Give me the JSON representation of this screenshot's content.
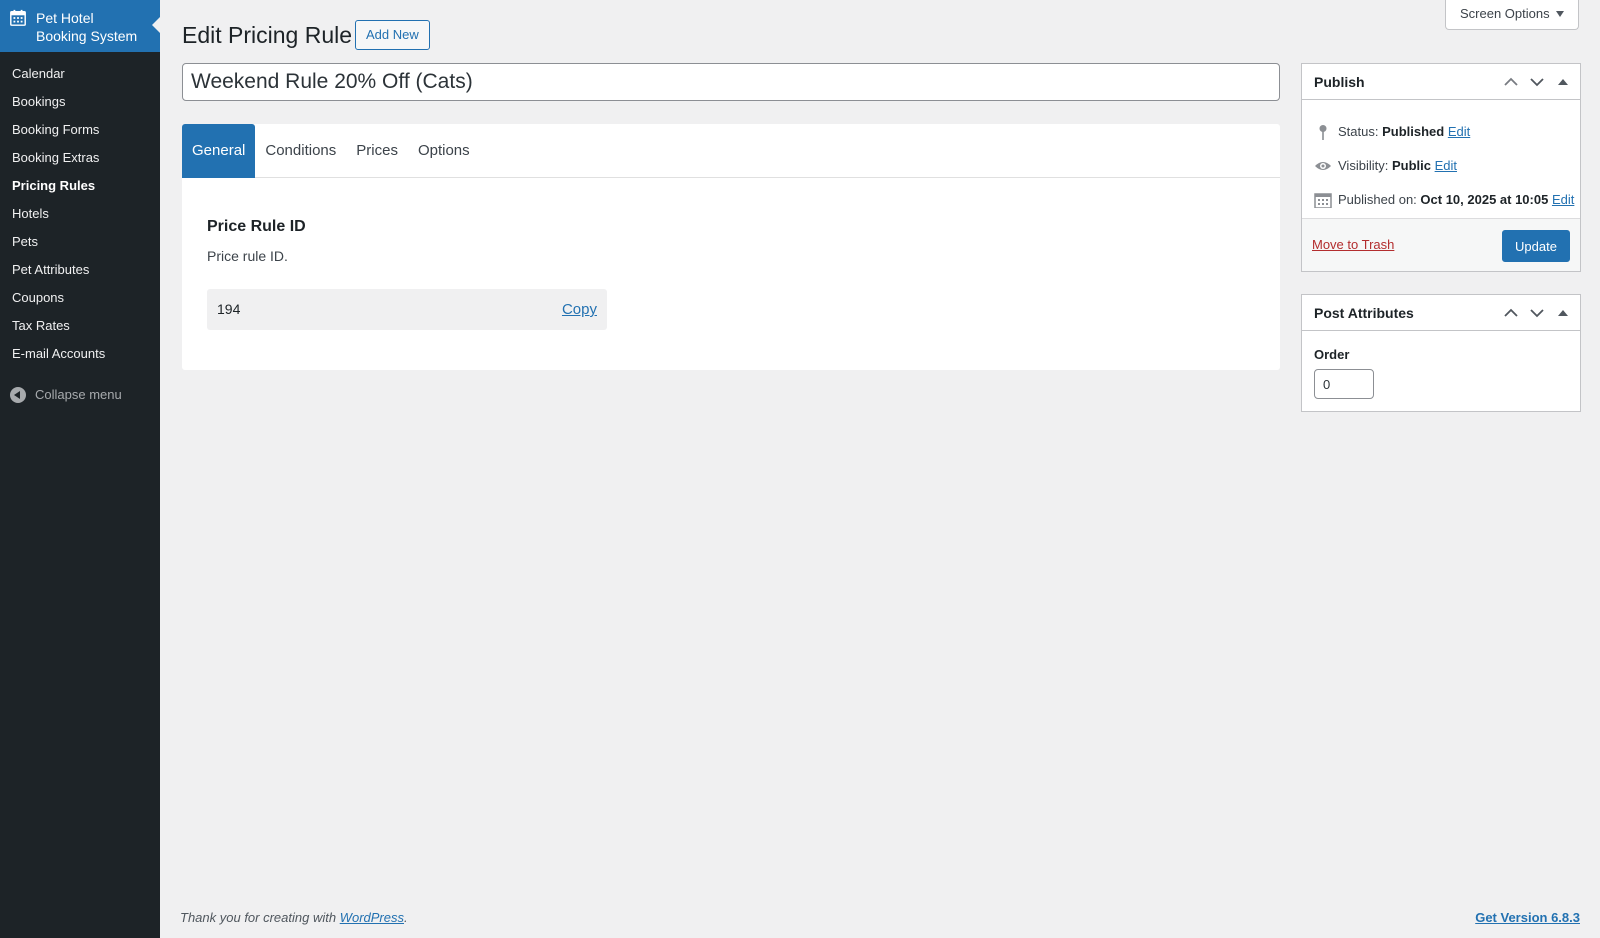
{
  "sidebar": {
    "brand_line1": "Pet Hotel",
    "brand_line2": "Booking System",
    "brand_icon": "calendar-icon",
    "items": [
      {
        "label": "Calendar"
      },
      {
        "label": "Bookings"
      },
      {
        "label": "Booking Forms"
      },
      {
        "label": "Booking Extras"
      },
      {
        "label": "Pricing Rules",
        "current": true
      },
      {
        "label": "Hotels"
      },
      {
        "label": "Pets"
      },
      {
        "label": "Pet Attributes"
      },
      {
        "label": "Coupons"
      },
      {
        "label": "Tax Rates"
      },
      {
        "label": "E-mail Accounts"
      }
    ],
    "collapse_label": "Collapse menu"
  },
  "screen_options": "Screen Options",
  "header": {
    "title": "Edit Pricing Rule",
    "add_new": "Add New"
  },
  "post_title": "Weekend Rule 20% Off (Cats)",
  "tabs": [
    "General",
    "Conditions",
    "Prices",
    "Options"
  ],
  "general": {
    "field_title": "Price Rule ID",
    "field_desc": "Price rule ID.",
    "id_value": "194",
    "copy_label": "Copy"
  },
  "publish": {
    "title": "Publish",
    "status_label": "Status:",
    "status_value": "Published",
    "visibility_label": "Visibility:",
    "visibility_value": "Public",
    "published_label": "Published on:",
    "published_value": "Oct 10, 2025 at 10:05",
    "edit": "Edit",
    "move_to_trash": "Move to Trash",
    "update": "Update"
  },
  "post_attributes": {
    "title": "Post Attributes",
    "order_label": "Order",
    "order_value": "0"
  },
  "footer": {
    "thanks_prefix": "Thank you for creating with ",
    "wordpress": "WordPress",
    "thanks_suffix": ".",
    "version": "Get Version 6.8.3"
  },
  "colors": {
    "accent": "#2271b1",
    "sidebar_bg": "#1d2327",
    "trash": "#b32d2e"
  }
}
